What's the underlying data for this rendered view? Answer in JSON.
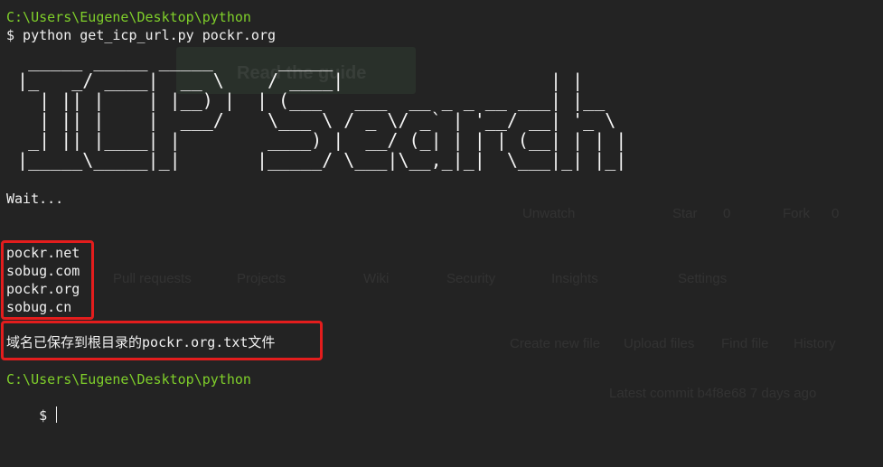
{
  "terminal": {
    "path_line_1": "C:\\Users\\Eugene\\Desktop\\python",
    "command": "$ python get_icp_url.py pockr.org",
    "banner": "  _____ _____ _____      _____\n |_   _/ ____|  __ \\    / ____|                   | |\n   | || |    | |__) |  | (___   ___  __ _ _ __ ___| |__\n   | || |    |  ___/    \\___ \\ / _ \\/ _` | '__/ __| '_ \\\n  _| || |____| |        ____) |  __/ (_| | | | (__| | | |\n |_____\\_____|_|       |_____/ \\___|\\__,_|_|  \\___|_| |_|",
    "wait": "Wait...",
    "domains": [
      "pockr.net",
      "sobug.com",
      "pockr.org",
      "sobug.cn"
    ],
    "saved_message": "域名已保存到根目录的pockr.org.txt文件",
    "path_line_2": "C:\\Users\\Eugene\\Desktop\\python",
    "prompt": "$"
  },
  "background_page": {
    "guide_button": "Read the guide",
    "watch": "Unwatch",
    "star": "Star",
    "fork": "Fork",
    "star_count": "0",
    "fork_count": "0",
    "tabs": [
      "Pull requests",
      "Projects",
      "Wiki",
      "Security",
      "Insights",
      "Settings"
    ],
    "file_actions": [
      "Create new file",
      "Upload files",
      "Find file",
      "History"
    ],
    "commit": "Latest commit b4f8e68 7 days ago"
  },
  "colors": {
    "background": "#232323",
    "path": "#7fcf2a",
    "text": "#f0f0f0",
    "highlight": "#e31d1d"
  }
}
